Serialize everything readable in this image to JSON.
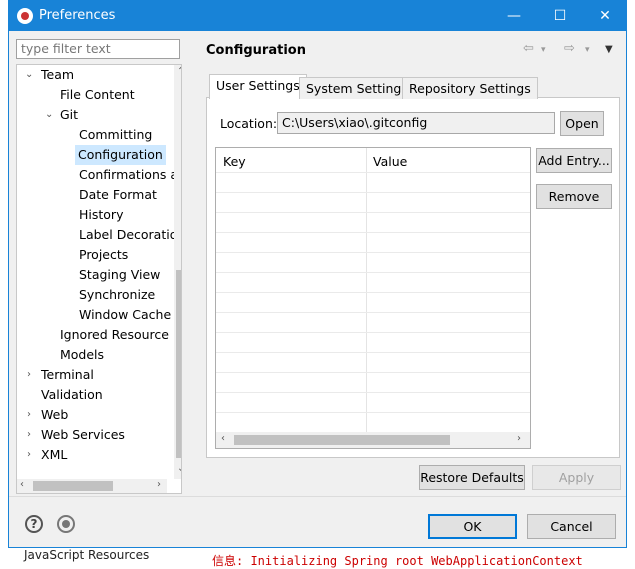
{
  "window": {
    "title": "Preferences",
    "minimize_label": "—",
    "maximize_label": "☐",
    "close_label": "✕"
  },
  "filter": {
    "placeholder": "type filter text"
  },
  "tree": {
    "items": [
      {
        "label": "Team"
      },
      {
        "label": "File Content"
      },
      {
        "label": "Git"
      },
      {
        "label": "Committing"
      },
      {
        "label": "Configuration"
      },
      {
        "label": "Confirmations a"
      },
      {
        "label": "Date Format"
      },
      {
        "label": "History"
      },
      {
        "label": "Label Decoratio"
      },
      {
        "label": "Projects"
      },
      {
        "label": "Staging View"
      },
      {
        "label": "Synchronize"
      },
      {
        "label": "Window Cache"
      },
      {
        "label": "Ignored Resource"
      },
      {
        "label": "Models"
      },
      {
        "label": "Terminal"
      },
      {
        "label": "Validation"
      },
      {
        "label": "Web"
      },
      {
        "label": "Web Services"
      },
      {
        "label": "XML"
      }
    ]
  },
  "main": {
    "title": "Configuration",
    "tabs": [
      {
        "label": "User Settings"
      },
      {
        "label": "System Settings"
      },
      {
        "label": "Repository Settings"
      }
    ],
    "location_label": "Location:",
    "location_value": "C:\\Users\\xiao\\.gitconfig",
    "open_label": "Open",
    "table": {
      "columns": [
        "Key",
        "Value"
      ]
    },
    "add_entry_label": "Add Entry...",
    "remove_label": "Remove",
    "restore_defaults_label": "Restore Defaults",
    "apply_label": "Apply"
  },
  "footer": {
    "ok_label": "OK",
    "cancel_label": "Cancel"
  },
  "background": {
    "bottom_text": "JavaScript Resources",
    "bottom_red": "信息: Initializing Spring root WebApplicationContext"
  },
  "colors": {
    "titlebar": "#1883d7",
    "selection": "#cde8ff"
  }
}
